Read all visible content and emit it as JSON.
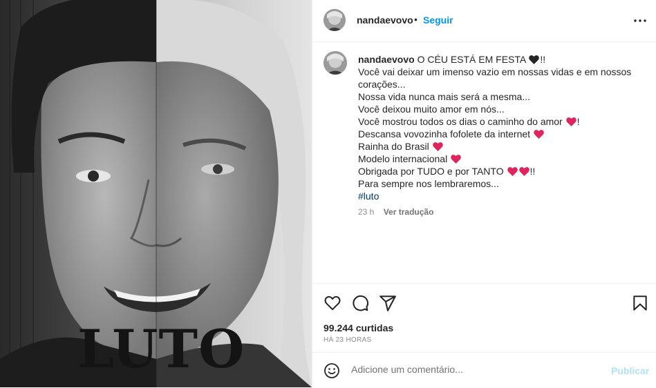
{
  "photo": {
    "overlay_text": "LUTO",
    "description_icon": "portrait-photo"
  },
  "header": {
    "username": "nandaevovo",
    "separator": "•",
    "follow_label": "Seguir",
    "more_icon": "more-horizontal-icon"
  },
  "caption": {
    "username": "nandaevovo",
    "lines": [
      "O CÉU ESTÁ EM FESTA",
      "Você vai deixar um imenso vazio em nossas vidas e em nossos corações...",
      "Nossa vida nunca mais será a mesma...",
      "Você deixou muito amor em nós...",
      "Você mostrou todos os dias o caminho do amor",
      "Descansa vovozinha fofolete da internet",
      "Rainha do Brasil",
      "Modelo internacional",
      "Obrigada por TUDO e por TANTO",
      "Para sempre nos lembraremos..."
    ],
    "exclaim": "!!",
    "exclaim_single": "!",
    "hashtag": "#luto",
    "time": "23 h",
    "translate_label": "Ver tradução"
  },
  "actions": {
    "likes": "99.244 curtidas",
    "ago": "HÁ 23 HORAS"
  },
  "comment": {
    "placeholder": "Adicione um comentário...",
    "post_label": "Publicar"
  },
  "colors": {
    "accent": "#0095f6",
    "heart": "#e0245e",
    "black_heart": "#262626",
    "hashtag": "#00376b"
  }
}
